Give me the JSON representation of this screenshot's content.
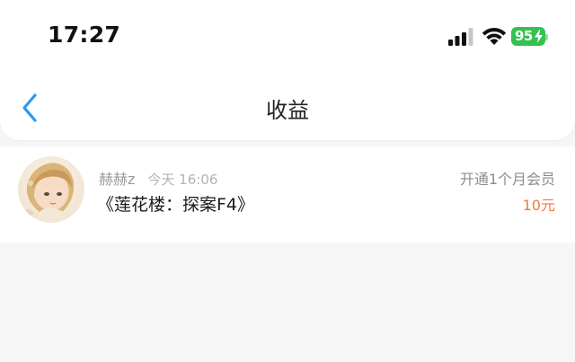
{
  "status_bar": {
    "time": "17:27",
    "battery": "95"
  },
  "nav": {
    "title": "收益"
  },
  "records": [
    {
      "user": "赫赫z",
      "time": "今天 16:06",
      "work_title": "《莲花楼：探案F4》",
      "order_type": "开通1个月会员",
      "amount": "10元"
    }
  ],
  "icons": {
    "back": "chevron-left-icon",
    "signal": "cellular-signal-icon",
    "wifi": "wifi-icon",
    "battery": "battery-charging-icon"
  },
  "colors": {
    "accent": "#2a9af3",
    "amount": "#f07a3a",
    "battery": "#33c24d"
  }
}
